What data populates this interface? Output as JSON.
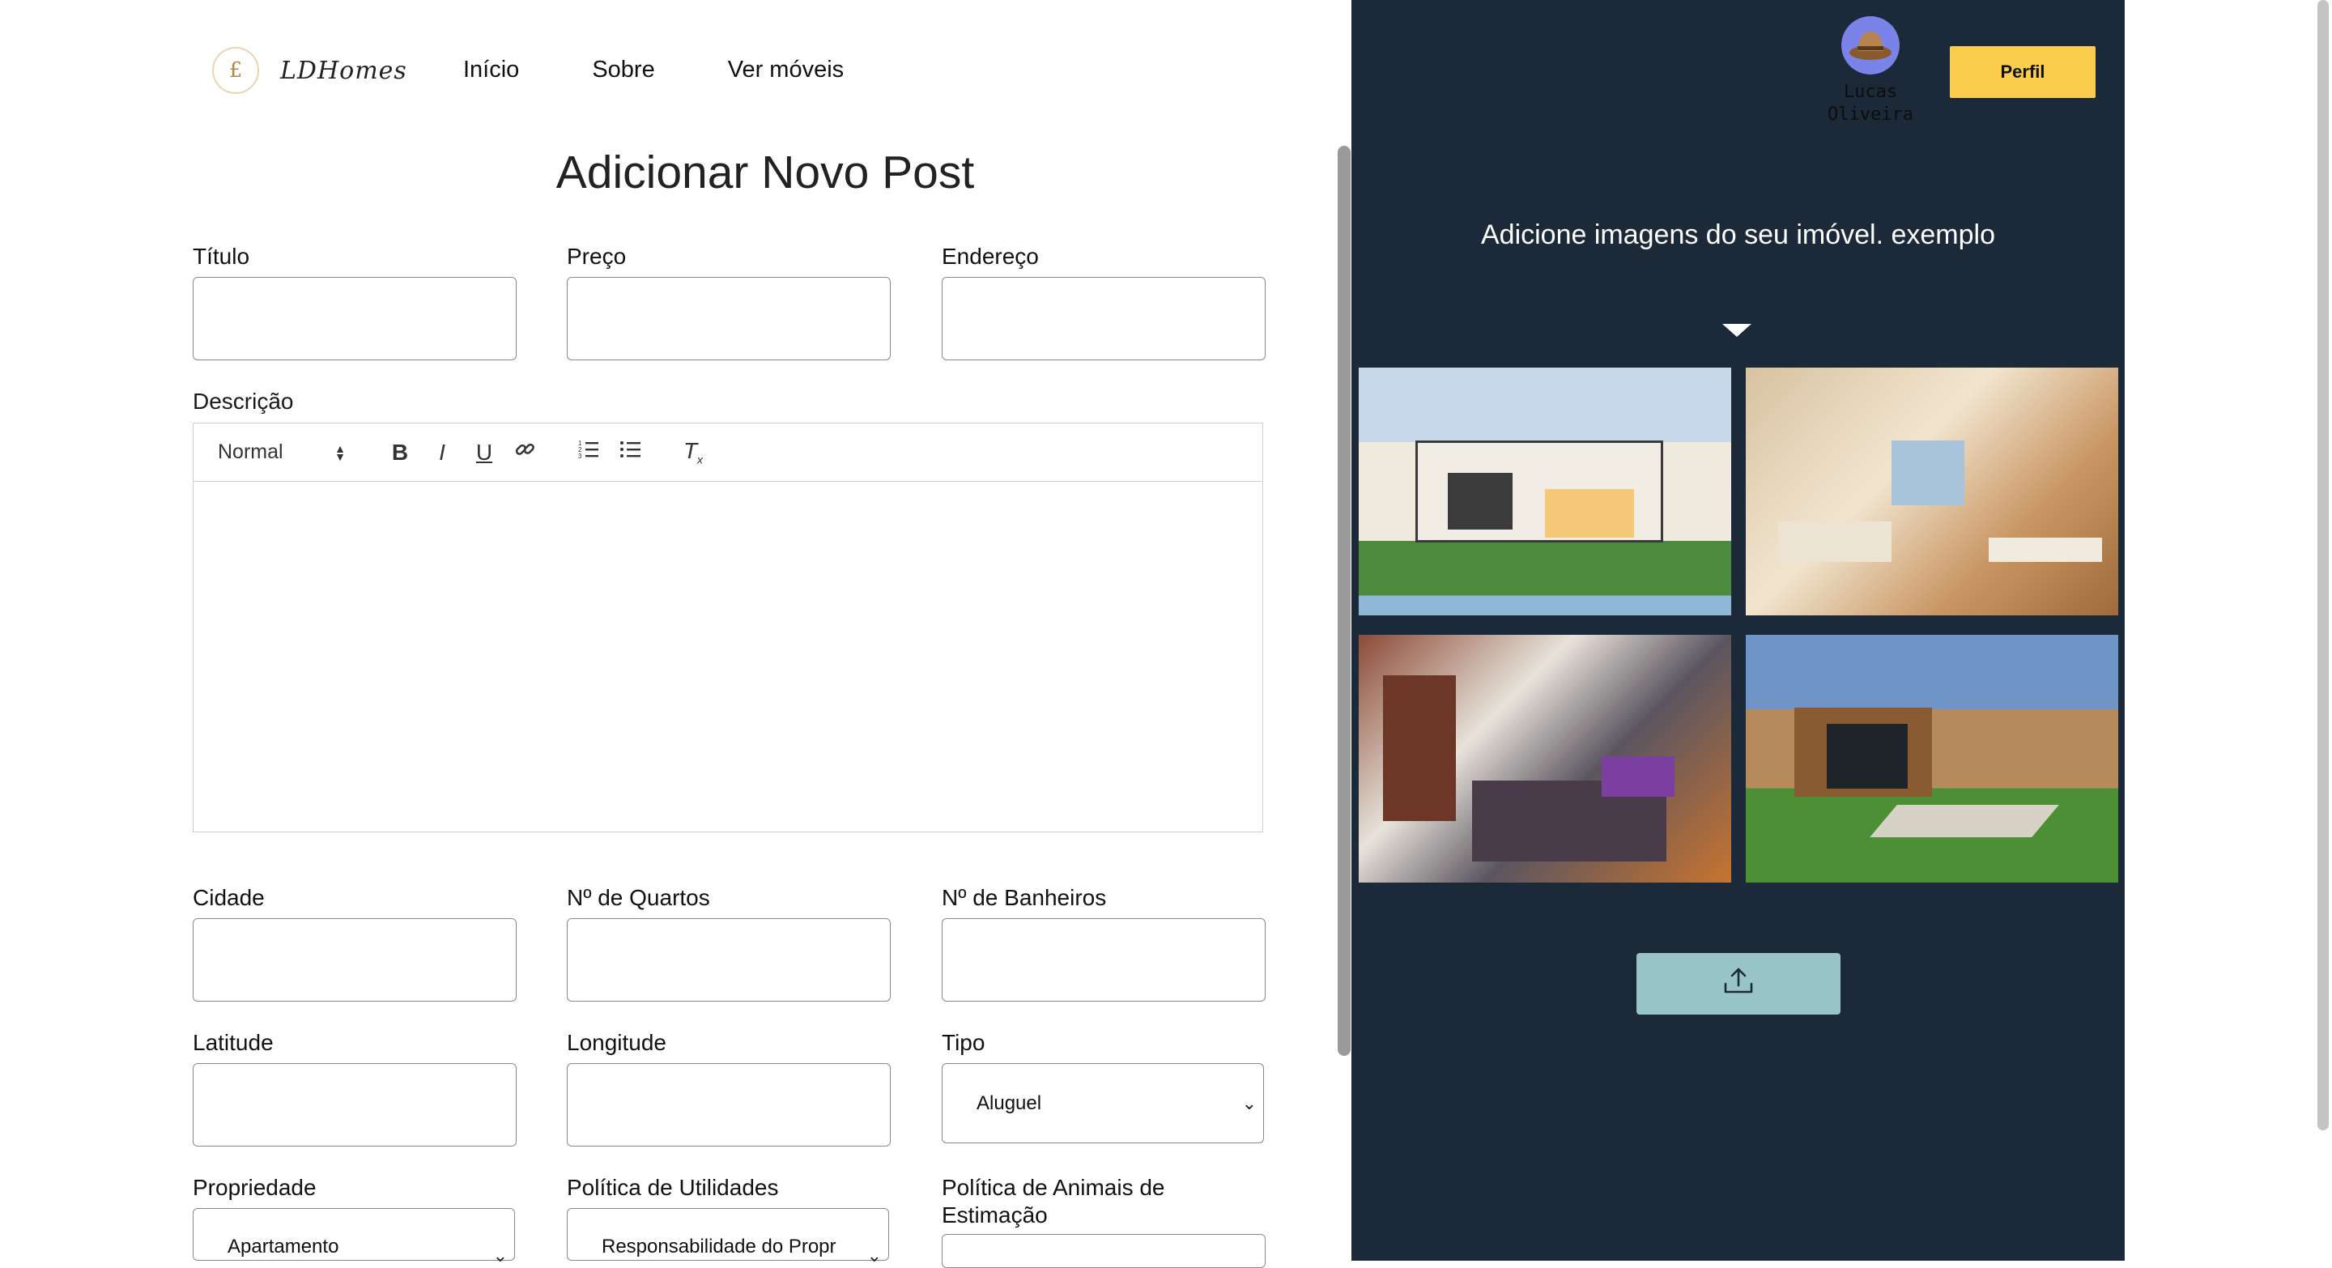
{
  "brand": {
    "logo_mark": "£",
    "name": "LDHomes"
  },
  "nav": {
    "items": [
      "Início",
      "Sobre",
      "Ver móveis"
    ]
  },
  "form": {
    "title": "Adicionar Novo Post",
    "labels": {
      "titulo": "Título",
      "preco": "Preço",
      "endereco": "Endereço",
      "descricao": "Descrição",
      "cidade": "Cidade",
      "quartos": "Nº de Quartos",
      "banheiros": "Nº de Banheiros",
      "latitude": "Latitude",
      "longitude": "Longitude",
      "tipo": "Tipo",
      "propriedade": "Propriedade",
      "utilidades": "Política de Utilidades",
      "animais": "Política de Animais de Estimação"
    },
    "values": {
      "tipo": "Aluguel",
      "propriedade": "Apartamento",
      "utilidades": "Responsabilidade do Propr"
    },
    "editor": {
      "format": "Normal",
      "icons": [
        "bold-icon",
        "italic-icon",
        "underline-icon",
        "link-icon",
        "ordered-list-icon",
        "bullet-list-icon",
        "clear-format-icon"
      ]
    }
  },
  "user": {
    "name": "Lucas Oliveira",
    "avatar_icon": "hat-avatar-icon"
  },
  "panel": {
    "profile_button": "Perfil",
    "instructions": "Adicione imagens do seu imóvel. exemplo",
    "upload_icon": "upload-icon",
    "background": "#1c2938",
    "accent": "#fbcd4e",
    "upload_color": "#98c4c5"
  }
}
